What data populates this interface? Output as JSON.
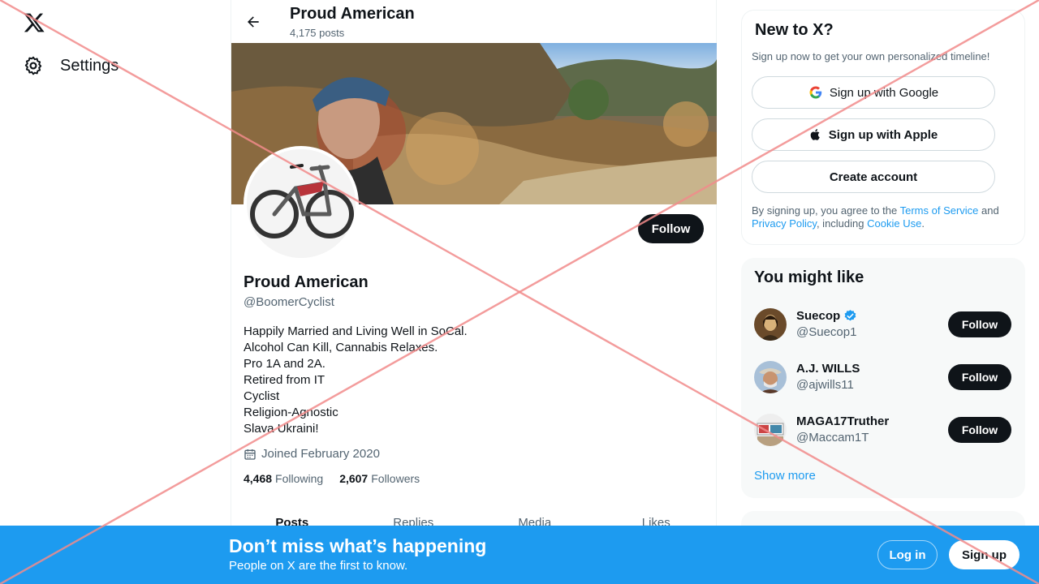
{
  "nav": {
    "settings_label": "Settings"
  },
  "header": {
    "title": "Proud American",
    "posts_count": "4,175 posts"
  },
  "profile": {
    "name": "Proud American",
    "handle": "@BoomerCyclist",
    "bio_lines": [
      "Happily Married and Living Well in SoCal.",
      "Alcohol Can Kill, Cannabis Relaxes.",
      "Pro 1A and 2A.",
      "Retired from IT",
      "Cyclist",
      "Religion-Agnostic",
      "Slava Ukraini!"
    ],
    "joined": "Joined February 2020",
    "following_count": "4,468",
    "following_label": "Following",
    "followers_count": "2,607",
    "followers_label": "Followers",
    "follow_label": "Follow"
  },
  "tabs": [
    "Posts",
    "Replies",
    "Media",
    "Likes"
  ],
  "new_to_x": {
    "title": "New to X?",
    "subtitle": "Sign up now to get your own personalized timeline!",
    "google_label": "Sign up with Google",
    "apple_label": "Sign up with Apple",
    "create_label": "Create account",
    "terms_prefix": "By signing up, you agree to the ",
    "terms_link": "Terms of Service",
    "terms_and": " and ",
    "privacy_link": "Privacy Policy",
    "terms_including": ", including ",
    "cookie_link": "Cookie Use",
    "terms_end": "."
  },
  "you_might_like": {
    "title": "You might like",
    "users": [
      {
        "name": "Suecop",
        "handle": "@Suecop1",
        "verified": true,
        "follow_label": "Follow"
      },
      {
        "name": "A.J. WILLS",
        "handle": "@ajwills11",
        "verified": false,
        "follow_label": "Follow"
      },
      {
        "name": "MAGA17Truther",
        "handle": "@Maccam1T",
        "verified": false,
        "follow_label": "Follow"
      }
    ],
    "show_more": "Show more"
  },
  "bottom_bar": {
    "title": "Don’t miss what’s happening",
    "subtitle": "People on X are the first to know.",
    "login_label": "Log in",
    "signup_label": "Sign up"
  },
  "colors": {
    "accent": "#1d9bf0",
    "text": "#0f1419",
    "muted": "#536471",
    "watermark": "#f28b8b"
  }
}
